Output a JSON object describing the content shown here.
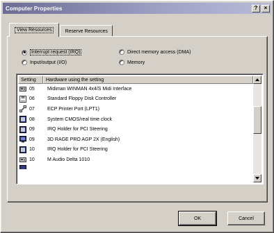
{
  "window": {
    "title": "Computer Properties",
    "help_button": "?",
    "close_button": "×"
  },
  "tabs": [
    {
      "label": "View Resources",
      "active": true
    },
    {
      "label": "Reserve Resources",
      "active": false
    }
  ],
  "resource_types": [
    {
      "label": "Interrupt request (IRQ)",
      "selected": true
    },
    {
      "label": "Input/output (I/O)",
      "selected": false
    },
    {
      "label": "Direct memory access (DMA)",
      "selected": false
    },
    {
      "label": "Memory",
      "selected": false
    }
  ],
  "list": {
    "columns": [
      "Setting",
      "Hardware using the setting"
    ],
    "rows": [
      {
        "setting": "05",
        "hardware": "Midiman WINMAN 4x4/S Midi Interface",
        "icon": "sound-card-icon"
      },
      {
        "setting": "06",
        "hardware": "Standard Floppy Disk Controller",
        "icon": "floppy-controller-icon"
      },
      {
        "setting": "07",
        "hardware": "ECP Printer Port (LPT1)",
        "icon": "printer-port-icon"
      },
      {
        "setting": "08",
        "hardware": "System CMOS/real time clock",
        "icon": "system-device-icon"
      },
      {
        "setting": "09",
        "hardware": "IRQ Holder for PCI Steering",
        "icon": "system-device-icon"
      },
      {
        "setting": "09",
        "hardware": "3D RAGE PRO AGP 2X (English)",
        "icon": "display-adapter-icon"
      },
      {
        "setting": "10",
        "hardware": "IRQ Holder for PCI Steering",
        "icon": "system-device-icon"
      },
      {
        "setting": "10",
        "hardware": "M Audio Delta 1010",
        "icon": "sound-card-icon"
      }
    ]
  },
  "buttons": {
    "ok": "OK",
    "cancel": "Cancel"
  }
}
